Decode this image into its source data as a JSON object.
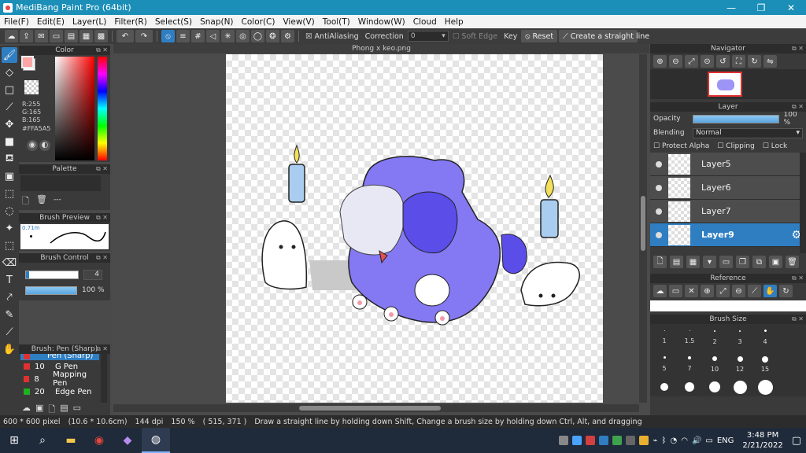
{
  "window": {
    "title": "MediBang Paint Pro (64bit)",
    "min": "—",
    "max": "❐",
    "close": "✕"
  },
  "menu": [
    "File(F)",
    "Edit(E)",
    "Layer(L)",
    "Filter(R)",
    "Select(S)",
    "Snap(N)",
    "Color(C)",
    "View(V)",
    "Tool(T)",
    "Window(W)",
    "Cloud",
    "Help"
  ],
  "toolbar": {
    "antialias_label": "AntiAliasing",
    "correction_label": "Correction",
    "correction_value": "0",
    "soft_edge_label": "Soft Edge",
    "key_label": "Key",
    "reset_label": "Reset",
    "straight_line_label": "Create a straight line"
  },
  "color_panel": {
    "title": "Color",
    "r": "R:255",
    "g": "G:165",
    "b": "B:165",
    "hex": "#FFA5A5",
    "fg_color": "#FFA5A5",
    "bg_color": "#FFFFFF"
  },
  "palette_panel": {
    "title": "Palette",
    "more": "---"
  },
  "brush_preview": {
    "title": "Brush Preview",
    "size": "0.71m"
  },
  "brush_control": {
    "title": "Brush Control",
    "size_value": "4",
    "opacity_value": "100 %"
  },
  "brush_list": {
    "title": "Brush: Pen (Sharp)",
    "items": [
      {
        "num": "",
        "name": "Pen (Sharp)",
        "color": "#e03030"
      },
      {
        "num": "10",
        "name": "G Pen",
        "color": "#e03030"
      },
      {
        "num": "8",
        "name": "Mapping Pen",
        "color": "#e03030"
      },
      {
        "num": "20",
        "name": "Edge Pen",
        "color": "#20b020"
      }
    ]
  },
  "document": {
    "tab_title": "Phong x keo.png"
  },
  "navigator": {
    "title": "Navigator"
  },
  "layer_panel": {
    "title": "Layer",
    "opacity_label": "Opacity",
    "opacity_value": "100 %",
    "opacity_fraction": 1.0,
    "blending_label": "Blending",
    "blending_value": "Normal",
    "protect_alpha": "Protect Alpha",
    "clipping": "Clipping",
    "lock": "Lock",
    "layers": [
      {
        "name": "Layer5",
        "selected": false
      },
      {
        "name": "Layer6",
        "selected": false
      },
      {
        "name": "Layer7",
        "selected": false
      },
      {
        "name": "Layer9",
        "selected": true
      }
    ]
  },
  "reference_panel": {
    "title": "Reference"
  },
  "brush_size_panel": {
    "title": "Brush Size",
    "row1": [
      "1",
      "1.5",
      "2",
      "3",
      "4"
    ],
    "row2": [
      "5",
      "7",
      "10",
      "12",
      "15"
    ]
  },
  "status": {
    "size": "600 * 600 pixel",
    "size_cm": "(10.6 * 10.6cm)",
    "dpi": "144 dpi",
    "zoom": "150 %",
    "coords": "( 515, 371 )",
    "hint": "Draw a straight line by holding down Shift, Change a brush size by holding down Ctrl, Alt, and dragging"
  },
  "taskbar": {
    "lang": "ENG",
    "time": "3:48 PM",
    "date": "2/21/2022"
  },
  "colors": {
    "accent": "#2f7ec2",
    "titlebar": "#1b8fb8",
    "purple": "#7a6ef0"
  }
}
